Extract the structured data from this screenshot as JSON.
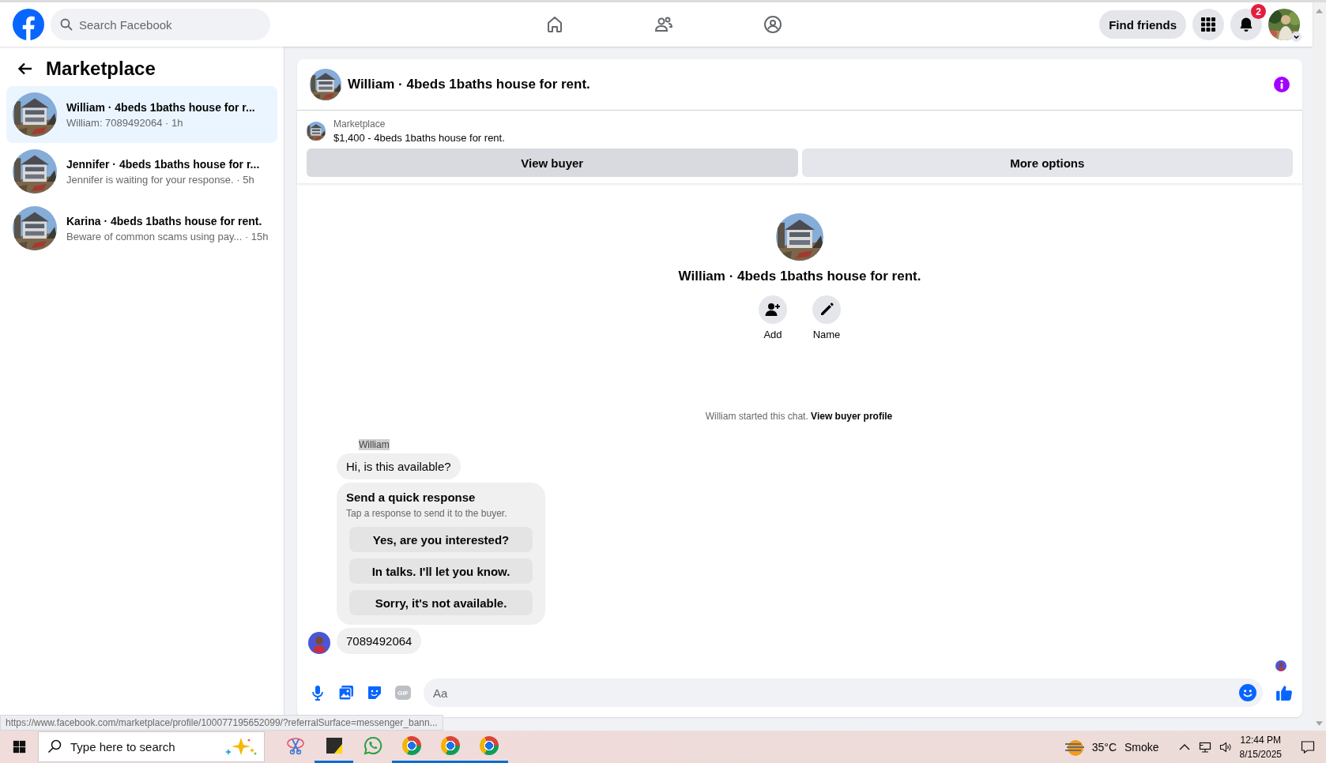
{
  "topbar": {
    "search": {
      "placeholder": "Search Facebook"
    },
    "find_friends": "Find friends",
    "notification_count": "2"
  },
  "sidebar": {
    "title": "Marketplace",
    "conversations": [
      {
        "title": "William · 4beds 1baths house for r...",
        "meta": "William: 7089492064 · 1h",
        "selected": true
      },
      {
        "title": "Jennifer · 4beds 1baths house for r...",
        "meta": "Jennifer is waiting for your response. · 5h",
        "selected": false
      },
      {
        "title": "Karina · 4beds 1baths house for rent.",
        "meta": "Beware of common scams using pay... · 15h",
        "selected": false
      }
    ]
  },
  "chat": {
    "title": "William · 4beds 1baths house for rent.",
    "listing": {
      "source": "Marketplace",
      "text": "$1,400 - 4beds 1baths house for rent."
    },
    "buttons": [
      "View buyer",
      "More options"
    ],
    "profile": {
      "name": "William · 4beds 1baths house for rent.",
      "actions": [
        {
          "kind": "add",
          "label": "Add"
        },
        {
          "kind": "rename",
          "label": "Name"
        }
      ]
    },
    "started": {
      "text": "William started this chat.",
      "link": "View buyer profile"
    },
    "sender": "William",
    "messages": [
      {
        "kind": "text",
        "text": "Hi, is this available?",
        "avatar": false
      },
      {
        "kind": "quick_responses",
        "title": "Send a quick response",
        "subtitle": "Tap a response to send it to the buyer.",
        "options": [
          "Yes, are you interested?",
          "In talks. I'll let you know.",
          "Sorry, it's not available."
        ]
      },
      {
        "kind": "text",
        "text": "7089492064",
        "avatar": true
      }
    ],
    "composer": {
      "gif": "GIF",
      "placeholder": "Aa"
    }
  },
  "status_url": "https://www.facebook.com/marketplace/profile/100077195652099/?referralSurface=messenger_bann...",
  "taskbar": {
    "search": {
      "placeholder": "Type here to search"
    },
    "apps": [
      {
        "kind": "paint",
        "running": false
      },
      {
        "kind": "notes",
        "running": true
      },
      {
        "kind": "whatsapp",
        "running": false
      },
      {
        "kind": "browser",
        "running": true
      },
      {
        "kind": "browser",
        "running": true
      },
      {
        "kind": "browser",
        "running": true
      }
    ],
    "weather": {
      "temperature": "35°C",
      "condition": "Smoke"
    },
    "time": "12:44 PM",
    "date": "8/15/2025"
  }
}
